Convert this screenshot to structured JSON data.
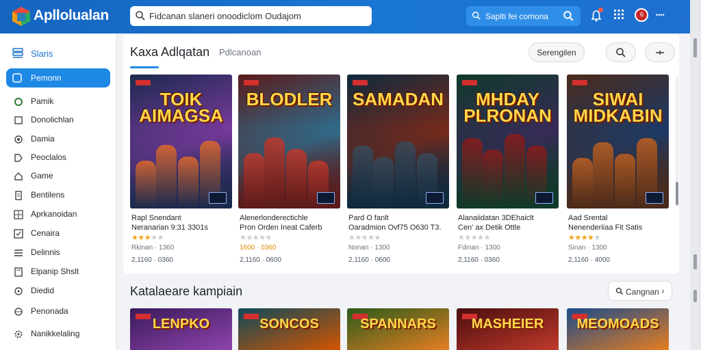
{
  "app": {
    "title": "Apllolualan",
    "logo_icon": "hexagon-logo-icon"
  },
  "search": {
    "value": "Fidcanan slaneri onoodiclom Oudajom",
    "placeholder": ""
  },
  "secondary_search": {
    "label": "Saplti fei comona"
  },
  "header_icons": [
    "notification-bell-icon",
    "apps-grid-icon",
    "user-avatar-icon"
  ],
  "user": {
    "avatar_initial": "6",
    "label": "••••"
  },
  "sidebar": {
    "heading": "Slaris",
    "active": "Pemonn",
    "items": [
      {
        "label": "Pamik",
        "icon": "circle-icon"
      },
      {
        "label": "Donolichlan",
        "icon": "square-icon"
      },
      {
        "label": "Damia",
        "icon": "ring-icon"
      },
      {
        "label": "Peoclalos",
        "icon": "tag-icon"
      },
      {
        "label": "Game",
        "icon": "home-icon"
      },
      {
        "label": "Bentilens",
        "icon": "document-icon"
      },
      {
        "label": "Aprkanoidan",
        "icon": "grid-icon"
      },
      {
        "label": "Cenaira",
        "icon": "checkbox-icon"
      },
      {
        "label": "Delinnis",
        "icon": "list-icon"
      },
      {
        "label": "Elpanip Shslt",
        "icon": "folder-icon"
      },
      {
        "label": "Diedid",
        "icon": "settings-icon"
      },
      {
        "label": "Penonada",
        "icon": "globe-icon"
      },
      {
        "label": "Nanikkelaling",
        "icon": "gear-icon"
      }
    ]
  },
  "section1": {
    "title": "Kaxa Adlqatan",
    "subtitle": "Pdlcanoan",
    "filter_label": "Serengilen",
    "cards": [
      {
        "cover": "TOIK AIMAGSA",
        "name": "Rapl Snendant",
        "sub": "Neranarian 9:31 3301s",
        "stars": 3,
        "meta1": "Rkinan · 1360",
        "meta2": "2,1160 · 0360",
        "meta_highlight": false,
        "palette": [
          "#1b2a4e",
          "#e06a2a",
          "#7a3a9e"
        ]
      },
      {
        "cover": "BLODLER",
        "name": "Alenerlonderectichle",
        "sub": "Pron Orden Ineat Caferb",
        "stars": 0,
        "meta1": "1600 · 0360",
        "meta2": "2,1160 · 0600",
        "meta_highlight": true,
        "palette": [
          "#5a1a1a",
          "#c0392b",
          "#2e6e8e"
        ]
      },
      {
        "cover": "SAMADAN",
        "name": "Pard O fanlt",
        "sub": "Oaradmion Ovf75 O630 T3.",
        "stars": 0,
        "meta1": "Nonan · 1300",
        "meta2": "2,1160 · 0600",
        "meta_highlight": false,
        "palette": [
          "#0e2a3e",
          "#3a4a5a",
          "#7a2a1a"
        ]
      },
      {
        "cover": "MHDAY PLRONAN",
        "name": "Alanaiidatan 3DEhaiclt",
        "sub": "Cen' ax Detik Ottle",
        "stars": 0,
        "meta1": "Fdinan · 1300",
        "meta2": "2,1160 · 0360",
        "meta_highlight": false,
        "palette": [
          "#0f3a2a",
          "#8e1a1a",
          "#3a2a5a"
        ]
      },
      {
        "cover": "SIWAI MIDKABIN",
        "name": "Aad Srental",
        "sub": "Nenenderiiaa Fit Satis",
        "stars": 4,
        "meta1": "Sinan · 1300",
        "meta2": "2,1160 · 4000",
        "meta_highlight": false,
        "palette": [
          "#4a2a1a",
          "#c06020",
          "#1a3a6a"
        ]
      }
    ]
  },
  "section2": {
    "title": "Katalaeare kampiain",
    "more_label": "Cangnan",
    "covers": [
      {
        "cover": "LENPKO",
        "palette": [
          "#3a1a5a",
          "#8e44ad"
        ]
      },
      {
        "cover": "SONCOS",
        "palette": [
          "#0e4a5a",
          "#d35400"
        ]
      },
      {
        "cover": "SPANNARS",
        "palette": [
          "#2a5a1a",
          "#e67e22"
        ]
      },
      {
        "cover": "MASHEIER",
        "palette": [
          "#4a0e0e",
          "#c0392b"
        ]
      },
      {
        "cover": "MEOMOADS",
        "palette": [
          "#1a4a8a",
          "#e67e22"
        ]
      }
    ]
  },
  "colors": {
    "primary": "#1976d2",
    "accent": "#1e88e5",
    "star": "#f2a31b"
  }
}
